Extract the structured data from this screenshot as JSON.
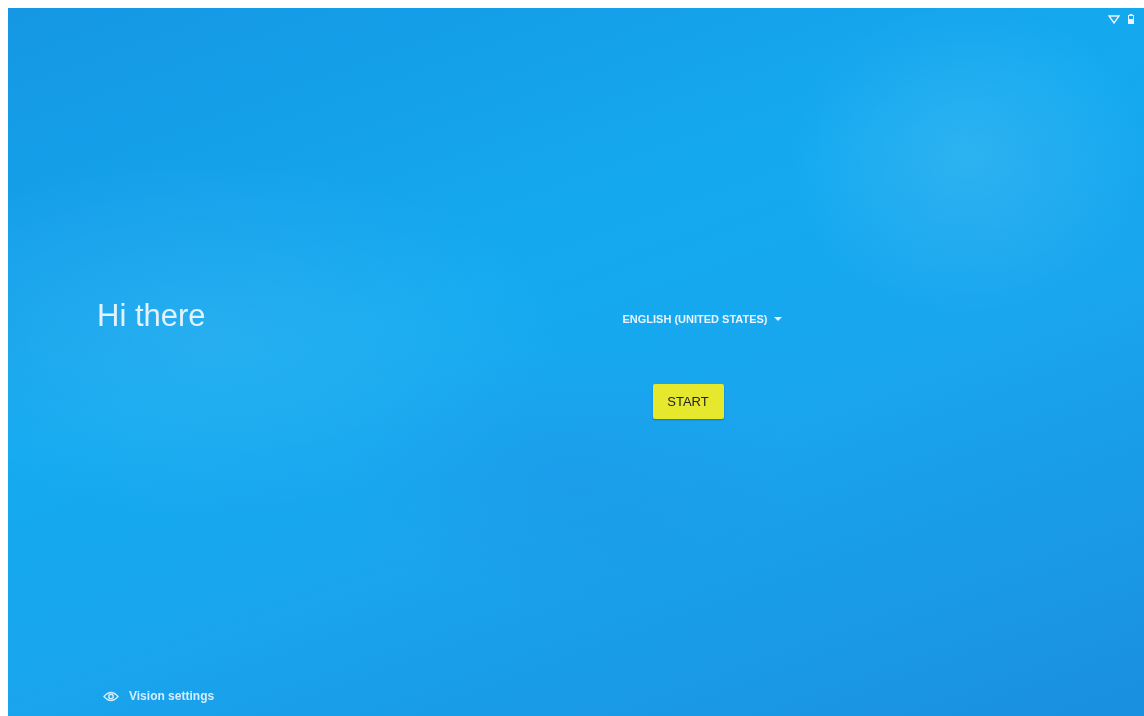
{
  "greeting": "Hi there",
  "language": {
    "label": "ENGLISH (UNITED STATES)"
  },
  "start_button": {
    "label": "START"
  },
  "footer": {
    "label": "Vision settings"
  }
}
